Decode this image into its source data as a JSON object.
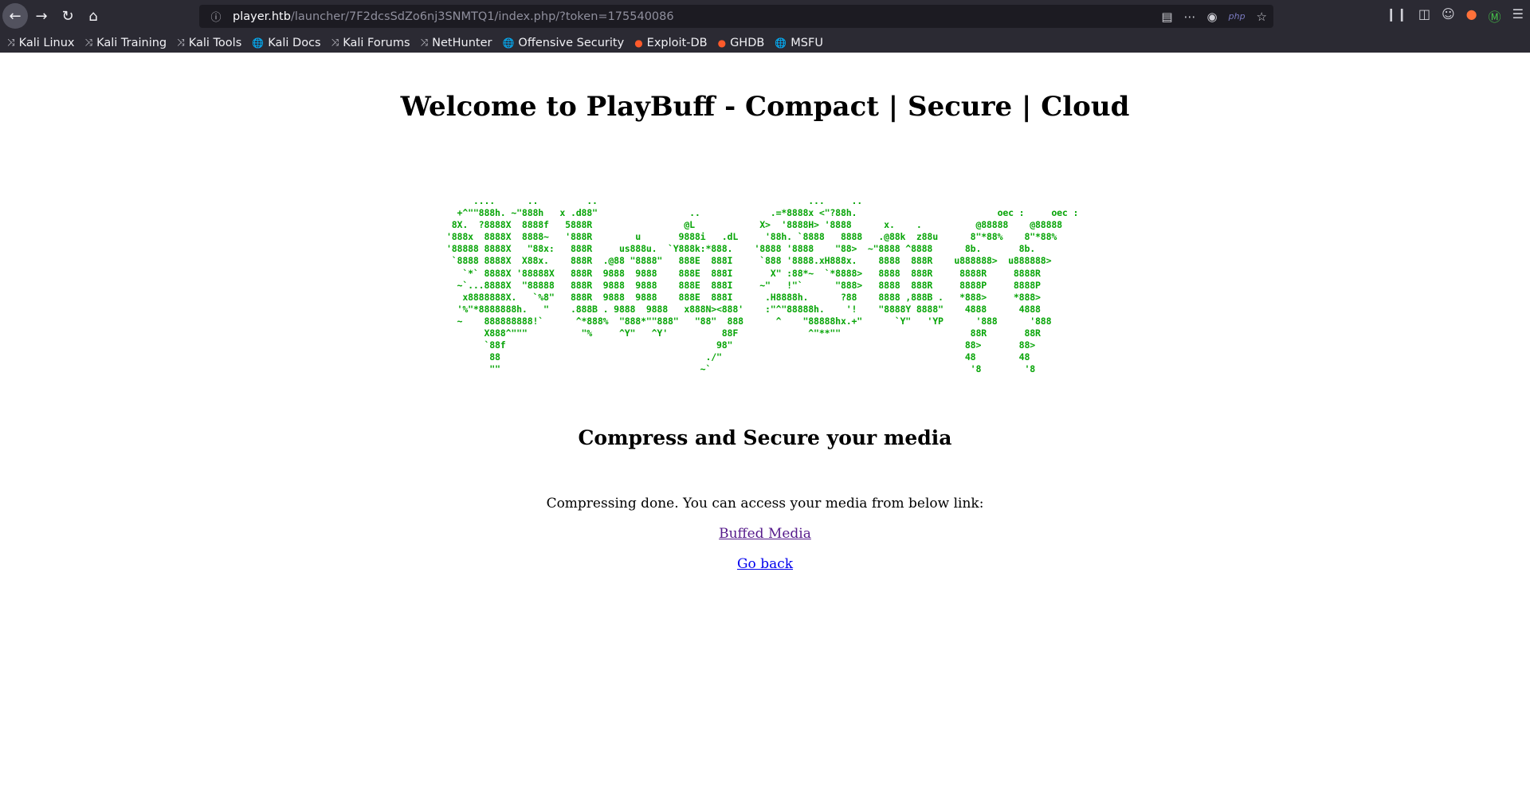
{
  "browser": {
    "url_host": "player.htb",
    "url_path": "/launcher/7F2dcsSdZo6nj3SNMTQ1/index.php/?token=175540086",
    "url_badge": "php",
    "bookmarks": [
      {
        "label": "Kali Linux",
        "icon": "kali-dragon-icon"
      },
      {
        "label": "Kali Training",
        "icon": "kali-dragon-icon"
      },
      {
        "label": "Kali Tools",
        "icon": "kali-dragon-icon"
      },
      {
        "label": "Kali Docs",
        "icon": "globe-icon"
      },
      {
        "label": "Kali Forums",
        "icon": "kali-dragon-icon"
      },
      {
        "label": "NetHunter",
        "icon": "kali-dragon-icon"
      },
      {
        "label": "Offensive Security",
        "icon": "globe-icon"
      },
      {
        "label": "Exploit-DB",
        "icon": "exploit-db-icon"
      },
      {
        "label": "GHDB",
        "icon": "exploit-db-icon"
      },
      {
        "label": "MSFU",
        "icon": "globe-icon"
      }
    ]
  },
  "page": {
    "title": "Welcome to PlayBuff - Compact | Secure | Cloud",
    "ascii_art": "     ....      ..         ..                                       ...     ..\n  +^\"\"888h. ~\"888h   x .d88\"                 ..             .=*8888x <\"?88h.                          oec :     oec :\n 8X.  ?8888X  8888f   5888R                 @L            X>  '8888H> '8888      x.    .          @88888    @88888\n'888x  8888X  8888~   '888R        u       9888i   .dL     '88h. `8888   8888   .@88k  z88u      8\"*88%    8\"*88%\n'88888 8888X   \"88x:   888R     us888u.  `Y888k:*888.    '8888 '8888    \"88>  ~\"8888 ^8888      8b.       8b.\n `8888 8888X  X88x.    888R  .@88 \"8888\"   888E  888I     `888 '8888.xH888x.    8888  888R    u888888>  u888888>\n   `*` 8888X '88888X   888R  9888  9888    888E  888I       X\" :88*~  `*8888>   8888  888R     8888R     8888R\n  ~`...8888X  \"88888   888R  9888  9888    888E  888I     ~\"   !\"`      \"888>   8888  888R     8888P     8888P\n   x8888888X.   `%8\"   888R  9888  9888    888E  888I      .H8888h.      ?88    8888 ,888B .   *888>     *888>\n  '%\"*8888888h.   \"    .888B . 9888  9888   x888N><888'    :\"^\"88888h.    '!    \"8888Y 8888\"    4888      4888\n  ~    888888888!`      ^*888%  \"888*\"\"888\"   \"88\"  888      ^    \"88888hx.+\"      `Y\"   'YP      '888      '888\n       X888^\"\"\"          \"%     ^Y\"   ^Y'          88F             ^\"**\"\"                        88R       88R\n       `88f                                       98\"                                           88>       88>\n        88                                      ./\"                                             48        48\n        \"\"                                     ~`                                                '8        '8",
    "subtitle": "Compress and Secure your media",
    "message": "Compressing done. You can access your media from below link:",
    "media_link": "Buffed Media",
    "back_link": "Go back"
  },
  "colors": {
    "ascii": "#08a508",
    "visited_link": "#551a8b",
    "link": "#0000ee",
    "chrome": "#2b2a33"
  }
}
